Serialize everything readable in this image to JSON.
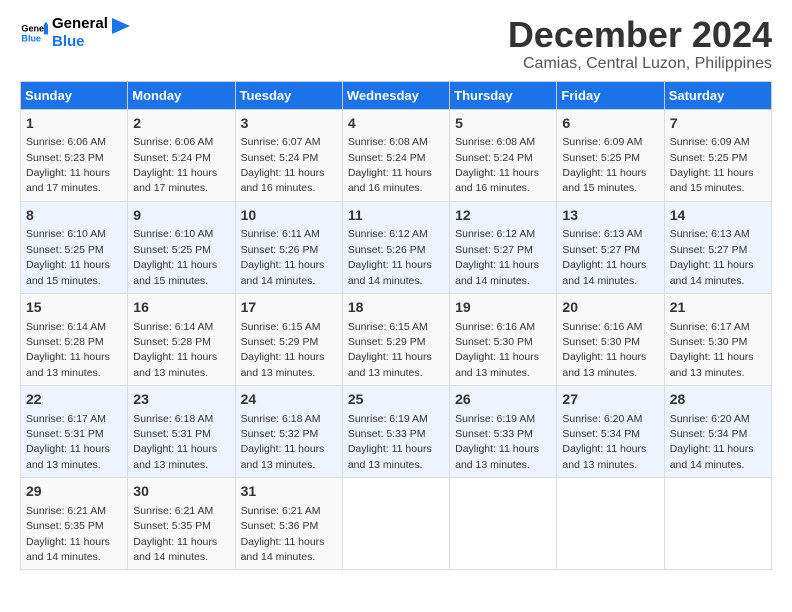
{
  "logo": {
    "line1": "General",
    "line2": "Blue"
  },
  "title": "December 2024",
  "subtitle": "Camias, Central Luzon, Philippines",
  "headers": [
    "Sunday",
    "Monday",
    "Tuesday",
    "Wednesday",
    "Thursday",
    "Friday",
    "Saturday"
  ],
  "weeks": [
    [
      {
        "day": "1",
        "sunrise": "6:06 AM",
        "sunset": "5:23 PM",
        "daylight": "11 hours and 17 minutes."
      },
      {
        "day": "2",
        "sunrise": "6:06 AM",
        "sunset": "5:24 PM",
        "daylight": "11 hours and 17 minutes."
      },
      {
        "day": "3",
        "sunrise": "6:07 AM",
        "sunset": "5:24 PM",
        "daylight": "11 hours and 16 minutes."
      },
      {
        "day": "4",
        "sunrise": "6:08 AM",
        "sunset": "5:24 PM",
        "daylight": "11 hours and 16 minutes."
      },
      {
        "day": "5",
        "sunrise": "6:08 AM",
        "sunset": "5:24 PM",
        "daylight": "11 hours and 16 minutes."
      },
      {
        "day": "6",
        "sunrise": "6:09 AM",
        "sunset": "5:25 PM",
        "daylight": "11 hours and 15 minutes."
      },
      {
        "day": "7",
        "sunrise": "6:09 AM",
        "sunset": "5:25 PM",
        "daylight": "11 hours and 15 minutes."
      }
    ],
    [
      {
        "day": "8",
        "sunrise": "6:10 AM",
        "sunset": "5:25 PM",
        "daylight": "11 hours and 15 minutes."
      },
      {
        "day": "9",
        "sunrise": "6:10 AM",
        "sunset": "5:25 PM",
        "daylight": "11 hours and 15 minutes."
      },
      {
        "day": "10",
        "sunrise": "6:11 AM",
        "sunset": "5:26 PM",
        "daylight": "11 hours and 14 minutes."
      },
      {
        "day": "11",
        "sunrise": "6:12 AM",
        "sunset": "5:26 PM",
        "daylight": "11 hours and 14 minutes."
      },
      {
        "day": "12",
        "sunrise": "6:12 AM",
        "sunset": "5:27 PM",
        "daylight": "11 hours and 14 minutes."
      },
      {
        "day": "13",
        "sunrise": "6:13 AM",
        "sunset": "5:27 PM",
        "daylight": "11 hours and 14 minutes."
      },
      {
        "day": "14",
        "sunrise": "6:13 AM",
        "sunset": "5:27 PM",
        "daylight": "11 hours and 14 minutes."
      }
    ],
    [
      {
        "day": "15",
        "sunrise": "6:14 AM",
        "sunset": "5:28 PM",
        "daylight": "11 hours and 13 minutes."
      },
      {
        "day": "16",
        "sunrise": "6:14 AM",
        "sunset": "5:28 PM",
        "daylight": "11 hours and 13 minutes."
      },
      {
        "day": "17",
        "sunrise": "6:15 AM",
        "sunset": "5:29 PM",
        "daylight": "11 hours and 13 minutes."
      },
      {
        "day": "18",
        "sunrise": "6:15 AM",
        "sunset": "5:29 PM",
        "daylight": "11 hours and 13 minutes."
      },
      {
        "day": "19",
        "sunrise": "6:16 AM",
        "sunset": "5:30 PM",
        "daylight": "11 hours and 13 minutes."
      },
      {
        "day": "20",
        "sunrise": "6:16 AM",
        "sunset": "5:30 PM",
        "daylight": "11 hours and 13 minutes."
      },
      {
        "day": "21",
        "sunrise": "6:17 AM",
        "sunset": "5:30 PM",
        "daylight": "11 hours and 13 minutes."
      }
    ],
    [
      {
        "day": "22",
        "sunrise": "6:17 AM",
        "sunset": "5:31 PM",
        "daylight": "11 hours and 13 minutes."
      },
      {
        "day": "23",
        "sunrise": "6:18 AM",
        "sunset": "5:31 PM",
        "daylight": "11 hours and 13 minutes."
      },
      {
        "day": "24",
        "sunrise": "6:18 AM",
        "sunset": "5:32 PM",
        "daylight": "11 hours and 13 minutes."
      },
      {
        "day": "25",
        "sunrise": "6:19 AM",
        "sunset": "5:33 PM",
        "daylight": "11 hours and 13 minutes."
      },
      {
        "day": "26",
        "sunrise": "6:19 AM",
        "sunset": "5:33 PM",
        "daylight": "11 hours and 13 minutes."
      },
      {
        "day": "27",
        "sunrise": "6:20 AM",
        "sunset": "5:34 PM",
        "daylight": "11 hours and 13 minutes."
      },
      {
        "day": "28",
        "sunrise": "6:20 AM",
        "sunset": "5:34 PM",
        "daylight": "11 hours and 14 minutes."
      }
    ],
    [
      {
        "day": "29",
        "sunrise": "6:21 AM",
        "sunset": "5:35 PM",
        "daylight": "11 hours and 14 minutes."
      },
      {
        "day": "30",
        "sunrise": "6:21 AM",
        "sunset": "5:35 PM",
        "daylight": "11 hours and 14 minutes."
      },
      {
        "day": "31",
        "sunrise": "6:21 AM",
        "sunset": "5:36 PM",
        "daylight": "11 hours and 14 minutes."
      },
      null,
      null,
      null,
      null
    ]
  ],
  "labels": {
    "sunrise": "Sunrise:",
    "sunset": "Sunset:",
    "daylight": "Daylight:"
  }
}
